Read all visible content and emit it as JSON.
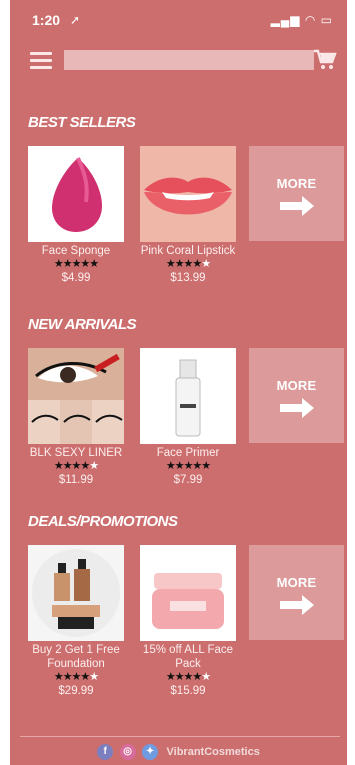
{
  "status": {
    "time": "1:20"
  },
  "search": {
    "placeholder": ""
  },
  "sections": [
    {
      "title": "BEST SELLERS",
      "items": [
        {
          "name": "Face Sponge",
          "rating": 5,
          "price": "$4.99"
        },
        {
          "name": "Pink Coral Lipstick",
          "rating": 4,
          "price": "$13.99"
        }
      ],
      "more_label": "MORE"
    },
    {
      "title": "NEW ARRIVALS",
      "items": [
        {
          "name": "BLK SEXY LINER",
          "rating": 4,
          "price": "$11.99"
        },
        {
          "name": "Face Primer",
          "rating": 5,
          "price": "$7.99"
        }
      ],
      "more_label": "MORE"
    },
    {
      "title": "DEALS/PROMOTIONS",
      "items": [
        {
          "name": "Buy 2 Get 1 Free Foundation",
          "rating": 4,
          "price": "$29.99"
        },
        {
          "name": "15% off ALL Face Pack",
          "rating": 4,
          "price": "$15.99"
        }
      ],
      "more_label": "MORE"
    }
  ],
  "footer": {
    "brand": "VibrantCosmetics",
    "social_icons": [
      "facebook-icon",
      "instagram-icon",
      "twitter-icon"
    ]
  },
  "colors": {
    "background": "#cc6e6e",
    "more_tile": "#dc9a9a"
  }
}
